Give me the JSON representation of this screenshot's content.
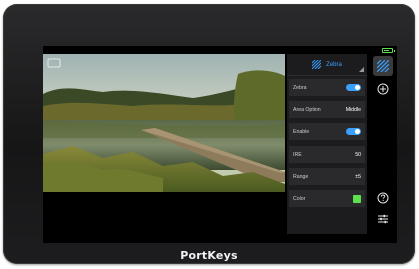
{
  "menu": {
    "title": "Zebra",
    "rows": [
      {
        "label": "Zebra",
        "kind": "toggle",
        "on": true
      },
      {
        "label": "Area Option",
        "kind": "value",
        "value": "Middle"
      },
      {
        "label": "Enable",
        "kind": "toggle",
        "on": true
      },
      {
        "label": "IRE",
        "kind": "value",
        "value": "50"
      },
      {
        "label": "Range",
        "kind": "value",
        "value": "±5"
      },
      {
        "label": "Color",
        "kind": "color",
        "value": "#5ee14e"
      }
    ]
  },
  "side_buttons": [
    "zebra-icon",
    "add-icon",
    "help-icon",
    "settings-sliders-icon"
  ],
  "status": {
    "battery_color": "#5ee14e"
  },
  "brand": {
    "logo": "PortKeys"
  },
  "colors": {
    "accent": "#3aa0ff",
    "zebra_color": "#5ee14e"
  }
}
